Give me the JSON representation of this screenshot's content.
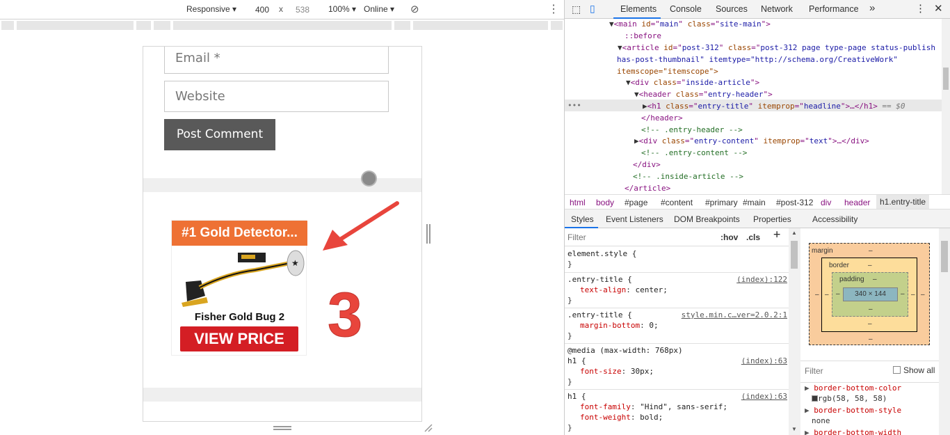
{
  "device_toolbar": {
    "device": "Responsive",
    "width": "400",
    "times": "x",
    "height": "538",
    "zoom": "100%",
    "network": "Online"
  },
  "page": {
    "email_placeholder": "Email *",
    "website_placeholder": "Website",
    "post_comment": "Post Comment",
    "ad_title": "#1 Gold Detector...",
    "ad_product": "Fisher Gold Bug 2",
    "ad_button": "VIEW PRICE",
    "annotation_number": "3",
    "colors": {
      "ad_header": "#ee7134",
      "ad_button": "#d41e24",
      "arrow": "#e8453c"
    }
  },
  "devtools": {
    "tabs": [
      "Elements",
      "Console",
      "Sources",
      "Network",
      "Performance"
    ],
    "more": "»",
    "dom_lines": [
      {
        "open": "▼",
        "tag": "<main ",
        "attrs": [
          [
            "id",
            "main"
          ],
          [
            "class",
            "site-main"
          ]
        ],
        "close": ">"
      },
      {
        "text": "::before"
      },
      {
        "open": "▼",
        "tag": "<article ",
        "attrs": [
          [
            "id",
            "post-312"
          ],
          [
            "class",
            "post-312 page type-page status-publish"
          ]
        ]
      },
      {
        "text": "has-post-thumbnail\" itemtype=\"http://schema.org/CreativeWork\""
      },
      {
        "text": "itemscope=\"itemscope\">"
      },
      {
        "open": "▼",
        "tag": "<div ",
        "attrs": [
          [
            "class",
            "inside-article"
          ]
        ],
        "close": ">"
      },
      {
        "open": "▼",
        "tag": "<header ",
        "attrs": [
          [
            "class",
            "entry-header"
          ]
        ],
        "close": ">"
      },
      {
        "open": "▶",
        "tag": "<h1 ",
        "attrs": [
          [
            "class",
            "entry-title"
          ],
          [
            "itemprop",
            "headline"
          ]
        ],
        "close": ">…</h1>",
        "suffix": " == $0"
      },
      {
        "text": "</header>"
      },
      {
        "comment": "<!-- .entry-header -->"
      },
      {
        "open": "▶",
        "tag": "<div ",
        "attrs": [
          [
            "class",
            "entry-content"
          ],
          [
            "itemprop",
            "text"
          ]
        ],
        "close": ">…</div>"
      },
      {
        "comment": "<!-- .entry-content -->"
      },
      {
        "text": "</div>"
      },
      {
        "comment": "<!-- .inside-article -->"
      },
      {
        "text": "</article>"
      }
    ],
    "breadcrumbs": [
      "html",
      "body",
      "#page",
      "#content",
      "#primary",
      "#main",
      "#post-312",
      "div",
      "header",
      "h1.entry-title"
    ],
    "sub_tabs": [
      "Styles",
      "Event Listeners",
      "DOM Breakpoints",
      "Properties",
      "Accessibility"
    ],
    "styles_filter_placeholder": "Filter",
    "hov": ":hov",
    "cls": ".cls",
    "plus": "+",
    "rules": [
      {
        "selector": "element.style {",
        "decls": [],
        "src": ""
      },
      {
        "selector": ".entry-title {",
        "decls": [
          [
            "text-align",
            "center;"
          ]
        ],
        "src": "(index):122"
      },
      {
        "selector": ".entry-title {",
        "decls": [
          [
            "margin-bottom",
            "0;"
          ]
        ],
        "src": "style.min.c…ver=2.0.2:1"
      },
      {
        "selector": "@media (max-width: 768px)",
        "sub": "h1 {",
        "decls": [
          [
            "font-size",
            "30px;"
          ]
        ],
        "src": "(index):63"
      },
      {
        "selector": "h1 {",
        "decls": [
          [
            "font-family",
            "\"Hind\", sans-serif;"
          ],
          [
            "font-weight",
            "bold;"
          ]
        ],
        "src": "(index):63"
      }
    ],
    "box_model": {
      "margin": "margin",
      "border": "border",
      "padding": "padding",
      "content": "340 × 144",
      "dash": "–"
    },
    "computed_filter": "Filter",
    "show_all": "Show all",
    "computed": [
      {
        "prop": "border-bottom-color",
        "value": "rgb(58, 58, 58)"
      },
      {
        "prop": "border-bottom-style",
        "value": "none"
      },
      {
        "prop": "border-bottom-width",
        "value": ""
      }
    ]
  }
}
